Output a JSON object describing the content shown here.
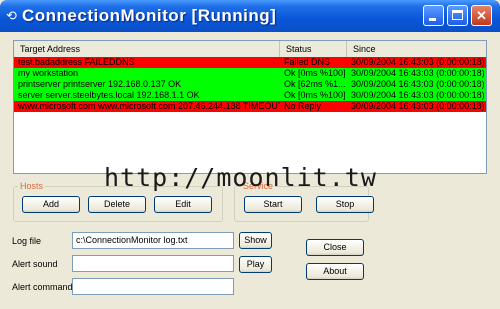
{
  "window": {
    "title": "ConnectionMonitor [Running]",
    "icon": "chain-link-icon",
    "controls": [
      "minimize",
      "maximize",
      "close"
    ]
  },
  "list": {
    "columns": [
      "Target Address",
      "Status",
      "Since"
    ],
    "rows": [
      {
        "address": "test.badaddress  FAILEDDNS",
        "status": "Failed DNS",
        "since": "30/09/2004 16:43:03 (0:00:00:18)",
        "state": "fail"
      },
      {
        "address": "my workstation",
        "status": "Ok [0ms %100]",
        "since": "30/09/2004 16:43:03 (0:00:00:18)",
        "state": "ok"
      },
      {
        "address": "printserver printserver 192.168.0.137 OK",
        "status": "Ok [62ms %1...",
        "since": "30/09/2004 16:43:03 (0:00:00:18)",
        "state": "ok"
      },
      {
        "address": "server server.steelbytes.local 192.168.1.1 OK",
        "status": "Ok [0ms %100]",
        "since": "30/09/2004 16:43:03 (0:00:00:18)",
        "state": "ok"
      },
      {
        "address": "www.microsoft.com www.microsoft.com 207.46.244.188 TIMEOUT",
        "status": "No Reply",
        "since": "30/09/2004 16:43:03 (0:00:00:18)",
        "state": "fail"
      }
    ]
  },
  "hosts_group": {
    "label": "Hosts",
    "add_label": "Add",
    "delete_label": "Delete",
    "edit_label": "Edit"
  },
  "service_group": {
    "label": "Service",
    "start_label": "Start",
    "stop_label": "Stop"
  },
  "settings": {
    "log_file_label": "Log file",
    "log_file_value": "c:\\ConnectionMonitor log.txt",
    "show_label": "Show",
    "alert_sound_label": "Alert sound",
    "alert_sound_value": "",
    "play_label": "Play",
    "alert_command_label": "Alert command",
    "alert_command_value": ""
  },
  "actions": {
    "close_label": "Close",
    "about_label": "About"
  },
  "watermark": "http://moonlit.tw",
  "colors": {
    "fail_row": "#ff0000",
    "ok_row": "#00ff00",
    "titlebar": "#0a56d8",
    "group_label": "#d76b3a"
  }
}
